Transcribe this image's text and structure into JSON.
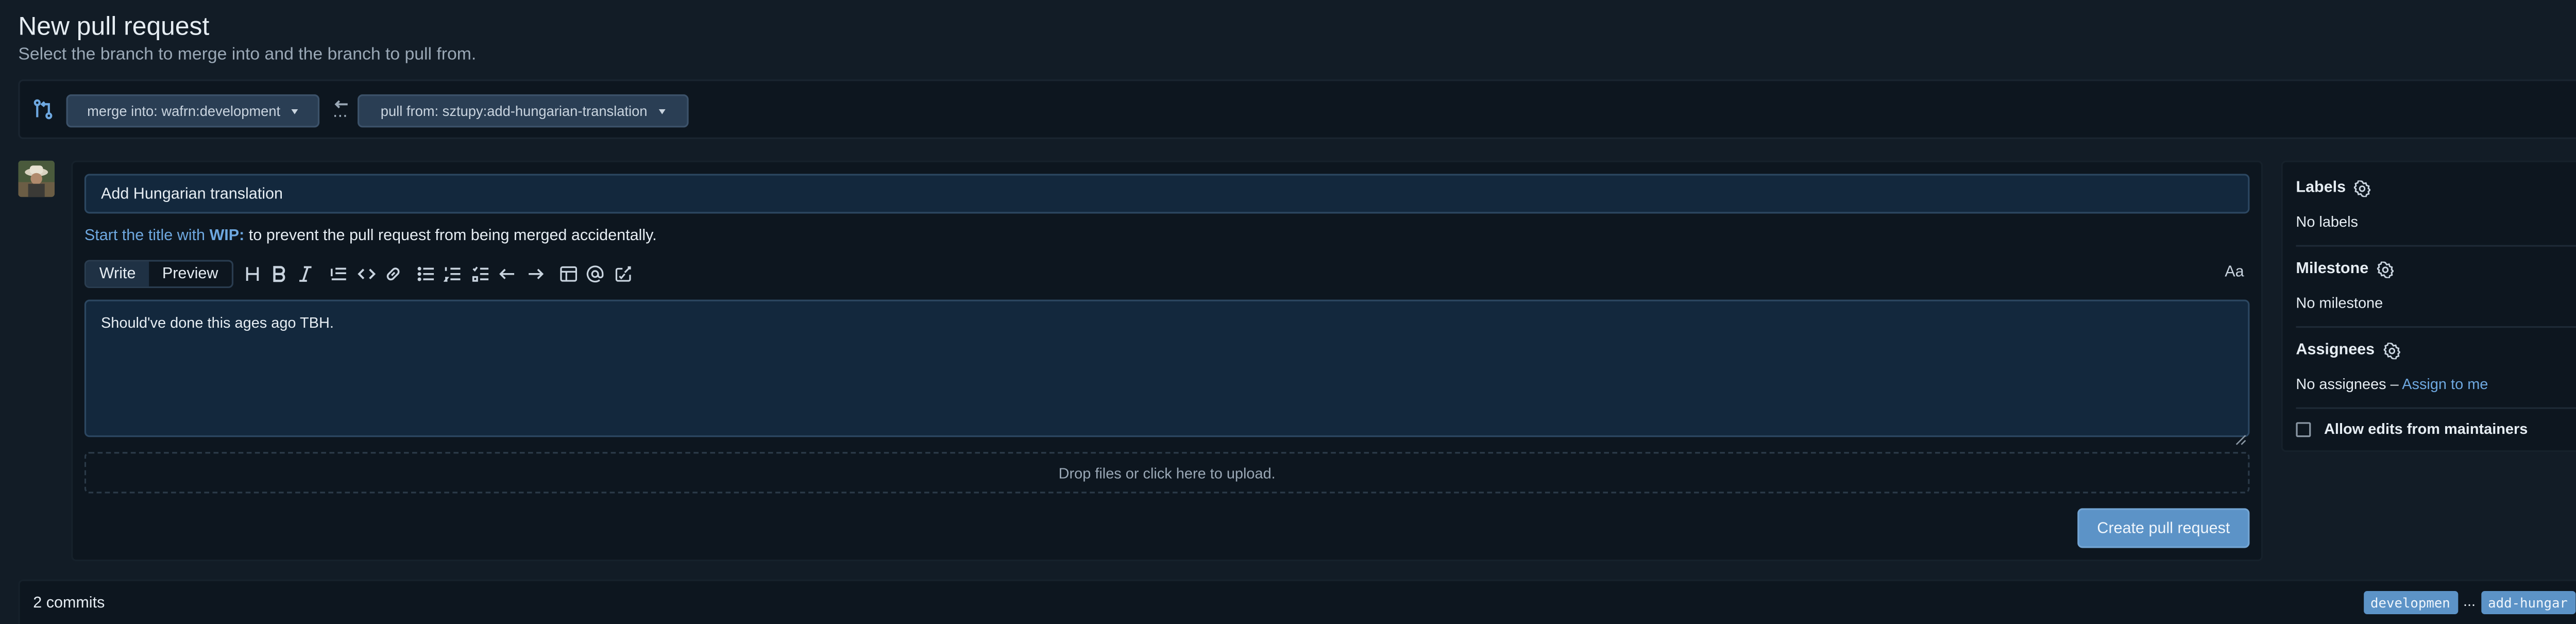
{
  "header": {
    "title": "New pull request",
    "subtitle": "Select the branch to merge into and the branch to pull from."
  },
  "branches": {
    "merge_into": "merge into: wafrn:development",
    "pull_from": "pull from: sztupy:add-hungarian-translation"
  },
  "form": {
    "title_value": "Add Hungarian translation",
    "wip_prefix": "Start the title with ",
    "wip_code": "WIP:",
    "wip_suffix": " to prevent the pull request from being merged accidentally.",
    "tabs": [
      "Write",
      "Preview"
    ],
    "font_toggle": "Aa",
    "body_value": "Should've done this ages ago TBH.",
    "drop_text": "Drop files or click here to upload.",
    "submit_label": "Create pull request"
  },
  "toolbar_icons": [
    "heading-icon",
    "bold-icon",
    "italic-icon",
    "quote-icon",
    "code-icon",
    "link-icon",
    "bullet-list-icon",
    "numbered-list-icon",
    "task-list-icon",
    "undo-icon",
    "redo-icon",
    "table-icon",
    "mention-icon",
    "reference-icon"
  ],
  "sidebar": {
    "labels_title": "Labels",
    "labels_value": "No labels",
    "milestone_title": "Milestone",
    "milestone_value": "No milestone",
    "assignees_title": "Assignees",
    "assignees_value": "No assignees – ",
    "assign_link": "Assign to me",
    "allow_edits": "Allow edits from maintainers"
  },
  "footer": {
    "commits": "2 commits",
    "base_ref": "developmen",
    "separator": "...",
    "head_ref": "add-hungar"
  },
  "colors": {
    "accent": "#5c93c7",
    "link": "#6ea8e0",
    "background": "#121c26"
  }
}
